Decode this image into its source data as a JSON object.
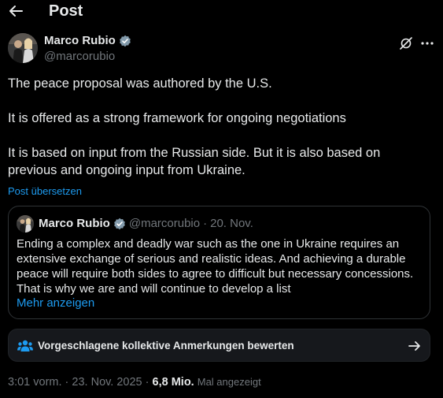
{
  "header": {
    "title": "Post"
  },
  "author": {
    "name": "Marco Rubio",
    "handle": "@marcorubio",
    "verified_color": "#829aab"
  },
  "post": {
    "paragraphs": [
      "The peace proposal was authored by the U.S.",
      "It is offered as a strong framework for ongoing negotiations",
      "It is based on input from the Russian side. But it is also based on previous and ongoing input from Ukraine."
    ],
    "translate_label": "Post übersetzen"
  },
  "quote": {
    "name": "Marco Rubio",
    "handle": "@marcorubio",
    "separator": "·",
    "date": "20. Nov.",
    "lines": [
      "Ending a complex and deadly war such as the one in Ukraine requires an",
      "extensive exchange of serious and realistic ideas. And achieving a durable",
      "peace will require both sides to agree to difficult but necessary concessions.",
      "That is why we are and will continue to develop a list"
    ],
    "show_more": "Mehr anzeigen"
  },
  "community_notes": {
    "label": "Vorgeschlagene kollektive Anmerkungen bewerten",
    "icon": "people-icon"
  },
  "meta": {
    "time": "3:01 vorm.",
    "sep1": "·",
    "date": "23. Nov. 2025",
    "sep2": "·",
    "views_count": "6,8 Mio.",
    "views_label": "Mal angezeigt"
  },
  "colors": {
    "background": "#000000",
    "text": "#e7e9ea",
    "muted": "#71767b",
    "link": "#1d9bf0",
    "border": "#2f3336"
  }
}
